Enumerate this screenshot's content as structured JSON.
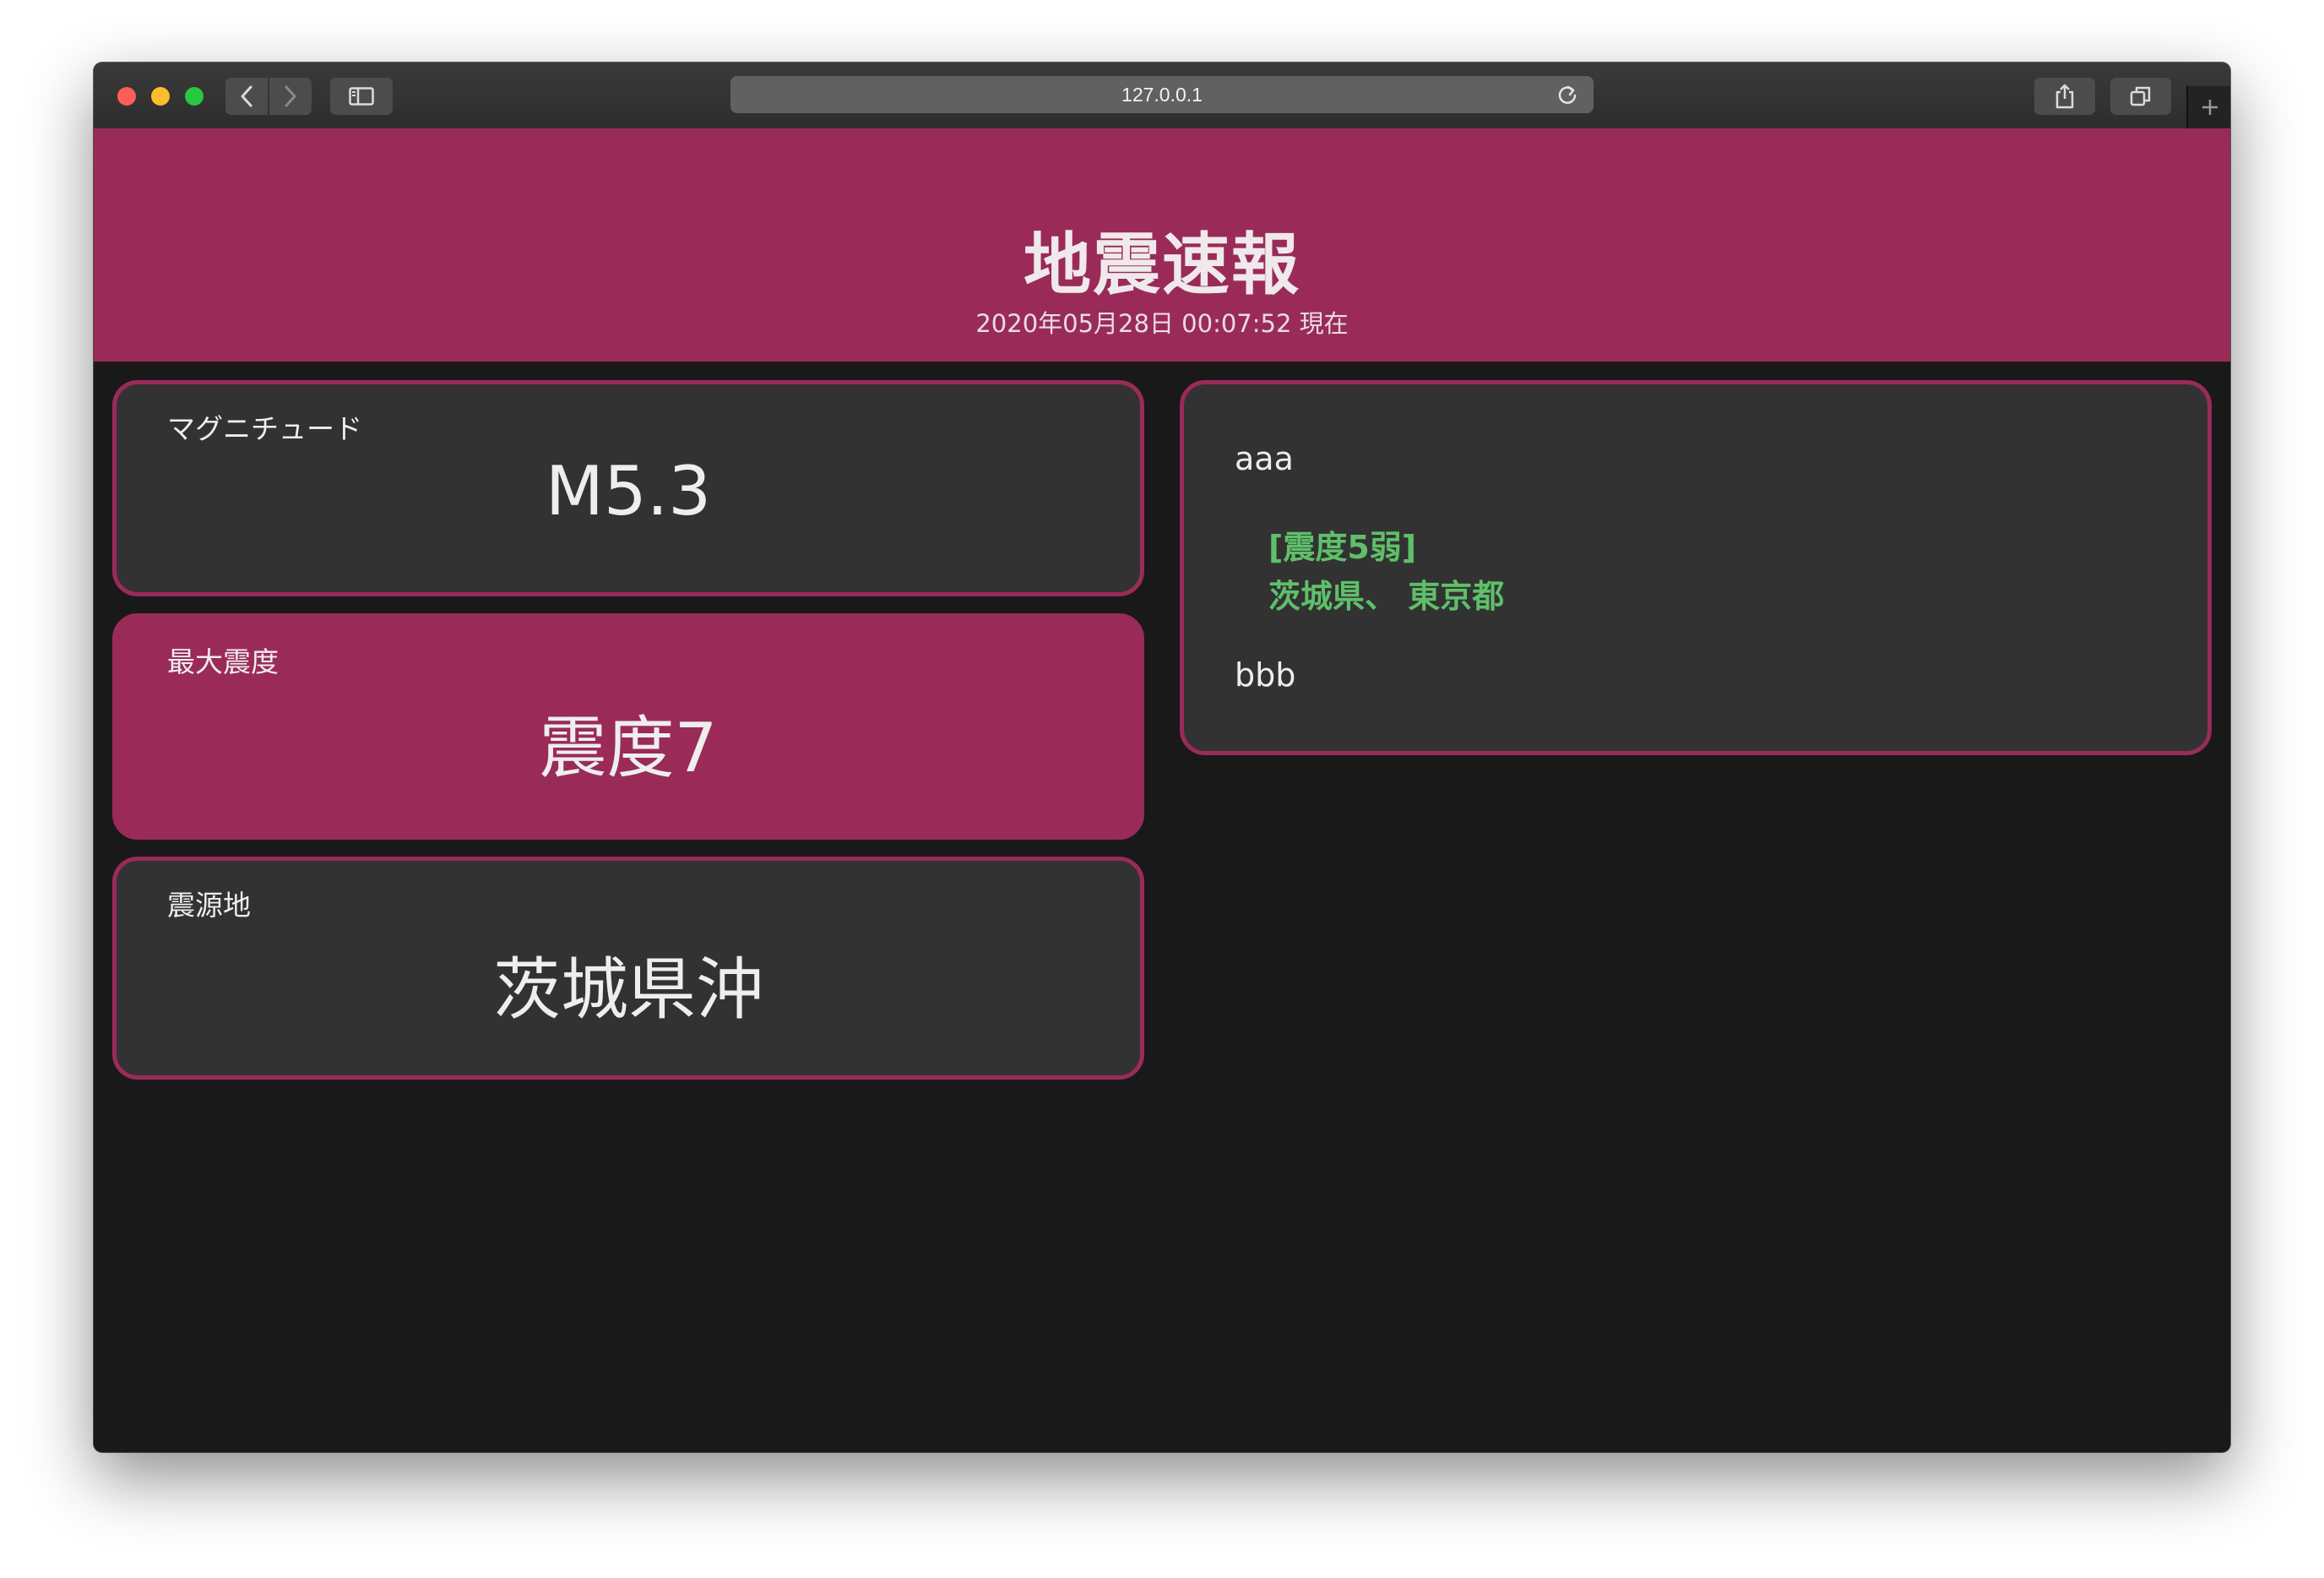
{
  "browser": {
    "url": "127.0.0.1"
  },
  "header": {
    "title": "地震速報",
    "timestamp": "2020年05月28日 00:07:52 現在"
  },
  "cards": {
    "magnitude": {
      "label": "マグニチュード",
      "value": "M5.3"
    },
    "max_intensity": {
      "label": "最大震度",
      "value": "震度7"
    },
    "epicenter": {
      "label": "震源地",
      "value": "茨城県沖"
    }
  },
  "detail": {
    "line1": "aaa",
    "intensity_group": "[震度5弱]",
    "regions": "茨城県、 東京都",
    "line2": "bbb"
  },
  "colors": {
    "accent": "#9a2b59",
    "background": "#191919",
    "card": "#323232",
    "region_text": "#5fbf6a"
  }
}
